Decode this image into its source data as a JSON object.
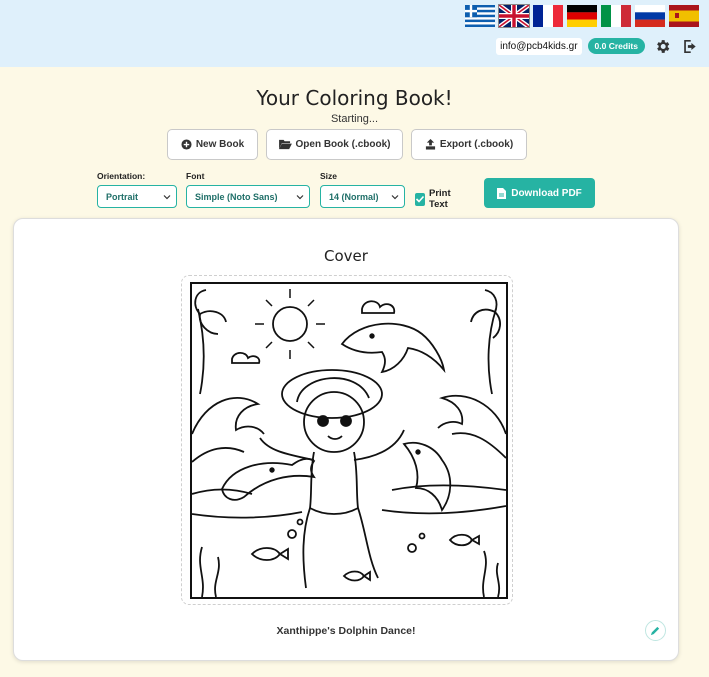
{
  "header": {
    "languages": [
      {
        "name": "greek-flag-icon",
        "code": "el"
      },
      {
        "name": "uk-flag-icon",
        "code": "en",
        "selected": true
      },
      {
        "name": "france-flag-icon",
        "code": "fr"
      },
      {
        "name": "germany-flag-icon",
        "code": "de"
      },
      {
        "name": "italy-flag-icon",
        "code": "it"
      },
      {
        "name": "russia-flag-icon",
        "code": "ru"
      },
      {
        "name": "spain-flag-icon",
        "code": "es"
      }
    ],
    "email": "info@pcb4kids.gr",
    "credits": "0.0 Credits",
    "settings_icon": "gear-icon",
    "logout_icon": "logout-icon"
  },
  "main": {
    "title": "Your Coloring Book!",
    "status": "Starting...",
    "buttons": {
      "new_book": "New Book",
      "open_book": "Open Book (.cbook)",
      "export": "Export (.cbook)"
    }
  },
  "controls": {
    "orientation": {
      "label": "Orientation:",
      "value": "Portrait"
    },
    "font": {
      "label": "Font",
      "value": "Simple (Noto Sans)"
    },
    "size": {
      "label": "Size",
      "value": "14 (Normal)"
    },
    "print_text": {
      "label": "Print Text",
      "checked": true
    },
    "download": "Download PDF"
  },
  "cover": {
    "title": "Cover",
    "caption": "Xanthippe's Dolphin Dance!"
  },
  "colors": {
    "accent": "#26b3a3",
    "header_bg": "#dff0fb",
    "page_bg": "#fdf9e6"
  }
}
